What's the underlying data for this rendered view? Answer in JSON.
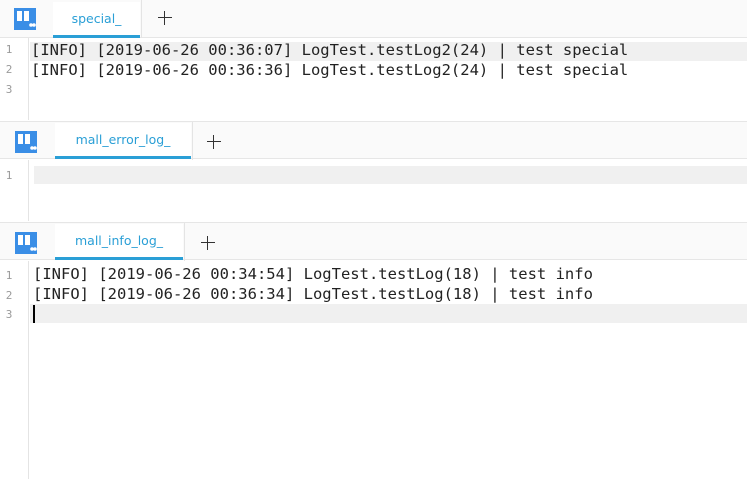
{
  "panes": [
    {
      "tab_label": "special_",
      "line_numbers": [
        "1",
        "2",
        "3"
      ],
      "lines": [
        "[INFO] [2019-06-26 00:36:07] LogTest.testLog2(24) | test special",
        "[INFO] [2019-06-26 00:36:36] LogTest.testLog2(24) | test special",
        ""
      ]
    },
    {
      "tab_label": "mall_error_log_",
      "line_numbers": [
        "1"
      ],
      "lines": [
        ""
      ]
    },
    {
      "tab_label": "mall_info_log_",
      "line_numbers": [
        "1",
        "2",
        "3"
      ],
      "lines": [
        "[INFO] [2019-06-26 00:34:54] LogTest.testLog(18) | test info",
        "[INFO] [2019-06-26 00:36:34] LogTest.testLog(18) | test info",
        ""
      ]
    }
  ],
  "icons": {
    "logo": "quote-logo-icon",
    "add": "plus-icon"
  },
  "colors": {
    "accent": "#2a9fd6",
    "logo": "#3a8ee6",
    "highlight": "#f0f0f0"
  }
}
